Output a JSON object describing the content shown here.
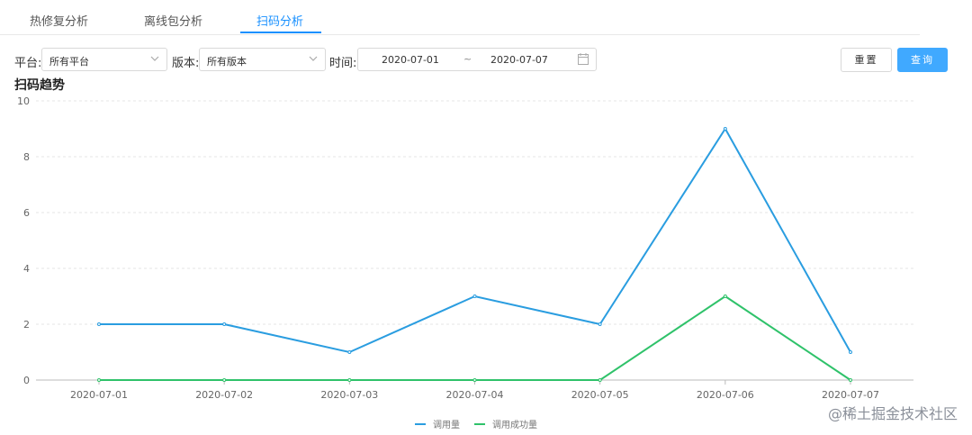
{
  "tabs": [
    {
      "label": "热修复分析",
      "active": false
    },
    {
      "label": "离线包分析",
      "active": false
    },
    {
      "label": "扫码分析",
      "active": true
    }
  ],
  "filters": {
    "platform_label": "平台:",
    "platform_value": "所有平台",
    "version_label": "版本:",
    "version_value": "所有版本",
    "time_label": "时间:",
    "date_start": "2020-07-01",
    "date_sep": "~",
    "date_end": "2020-07-07",
    "reset_label": "重置",
    "query_label": "查询"
  },
  "chart_title": "扫码趋势",
  "colors": {
    "accent": "#1890ff",
    "series_call": "#2a9de0",
    "series_success": "#2fc26a"
  },
  "chart_data": {
    "type": "line",
    "categories": [
      "2020-07-01",
      "2020-07-02",
      "2020-07-03",
      "2020-07-04",
      "2020-07-05",
      "2020-07-06",
      "2020-07-07"
    ],
    "series": [
      {
        "name": "调用量",
        "values": [
          2,
          2,
          1,
          3,
          2,
          9,
          1
        ]
      },
      {
        "name": "调用成功量",
        "values": [
          0,
          0,
          0,
          0,
          0,
          3,
          0
        ]
      }
    ],
    "ylim": [
      0,
      10
    ],
    "yticks": [
      0,
      2,
      4,
      6,
      8,
      10
    ],
    "grid": true,
    "legend": "bottom-center"
  },
  "watermark": "@稀土掘金技术社区"
}
